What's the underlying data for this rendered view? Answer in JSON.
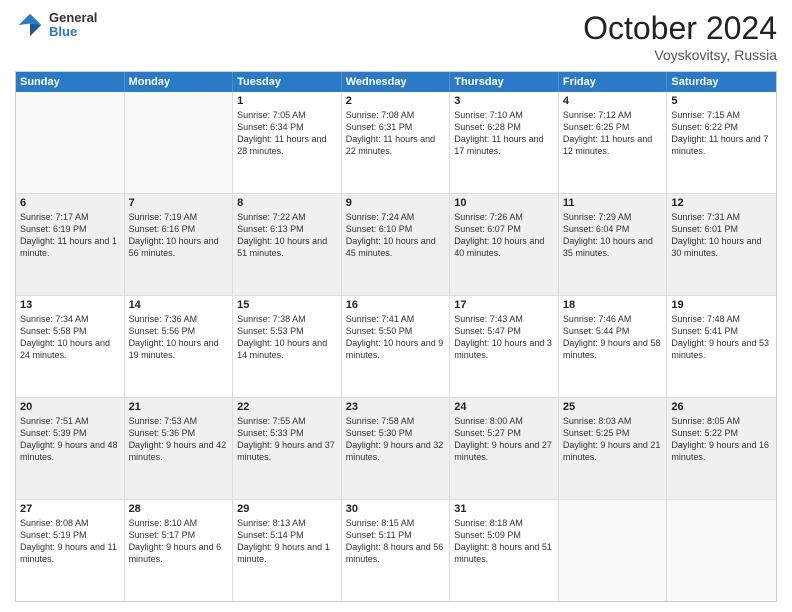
{
  "logo": {
    "general": "General",
    "blue": "Blue"
  },
  "header": {
    "month": "October 2024",
    "location": "Voyskovitsy, Russia"
  },
  "weekdays": [
    "Sunday",
    "Monday",
    "Tuesday",
    "Wednesday",
    "Thursday",
    "Friday",
    "Saturday"
  ],
  "rows": [
    [
      {
        "day": "",
        "empty": true
      },
      {
        "day": "",
        "empty": true
      },
      {
        "day": "1",
        "sunrise": "7:05 AM",
        "sunset": "6:34 PM",
        "daylight": "11 hours and 28 minutes."
      },
      {
        "day": "2",
        "sunrise": "7:08 AM",
        "sunset": "6:31 PM",
        "daylight": "11 hours and 22 minutes."
      },
      {
        "day": "3",
        "sunrise": "7:10 AM",
        "sunset": "6:28 PM",
        "daylight": "11 hours and 17 minutes."
      },
      {
        "day": "4",
        "sunrise": "7:12 AM",
        "sunset": "6:25 PM",
        "daylight": "11 hours and 12 minutes."
      },
      {
        "day": "5",
        "sunrise": "7:15 AM",
        "sunset": "6:22 PM",
        "daylight": "11 hours and 7 minutes."
      }
    ],
    [
      {
        "day": "6",
        "sunrise": "7:17 AM",
        "sunset": "6:19 PM",
        "daylight": "11 hours and 1 minute."
      },
      {
        "day": "7",
        "sunrise": "7:19 AM",
        "sunset": "6:16 PM",
        "daylight": "10 hours and 56 minutes."
      },
      {
        "day": "8",
        "sunrise": "7:22 AM",
        "sunset": "6:13 PM",
        "daylight": "10 hours and 51 minutes."
      },
      {
        "day": "9",
        "sunrise": "7:24 AM",
        "sunset": "6:10 PM",
        "daylight": "10 hours and 45 minutes."
      },
      {
        "day": "10",
        "sunrise": "7:26 AM",
        "sunset": "6:07 PM",
        "daylight": "10 hours and 40 minutes."
      },
      {
        "day": "11",
        "sunrise": "7:29 AM",
        "sunset": "6:04 PM",
        "daylight": "10 hours and 35 minutes."
      },
      {
        "day": "12",
        "sunrise": "7:31 AM",
        "sunset": "6:01 PM",
        "daylight": "10 hours and 30 minutes."
      }
    ],
    [
      {
        "day": "13",
        "sunrise": "7:34 AM",
        "sunset": "5:58 PM",
        "daylight": "10 hours and 24 minutes."
      },
      {
        "day": "14",
        "sunrise": "7:36 AM",
        "sunset": "5:56 PM",
        "daylight": "10 hours and 19 minutes."
      },
      {
        "day": "15",
        "sunrise": "7:38 AM",
        "sunset": "5:53 PM",
        "daylight": "10 hours and 14 minutes."
      },
      {
        "day": "16",
        "sunrise": "7:41 AM",
        "sunset": "5:50 PM",
        "daylight": "10 hours and 9 minutes."
      },
      {
        "day": "17",
        "sunrise": "7:43 AM",
        "sunset": "5:47 PM",
        "daylight": "10 hours and 3 minutes."
      },
      {
        "day": "18",
        "sunrise": "7:46 AM",
        "sunset": "5:44 PM",
        "daylight": "9 hours and 58 minutes."
      },
      {
        "day": "19",
        "sunrise": "7:48 AM",
        "sunset": "5:41 PM",
        "daylight": "9 hours and 53 minutes."
      }
    ],
    [
      {
        "day": "20",
        "sunrise": "7:51 AM",
        "sunset": "5:39 PM",
        "daylight": "9 hours and 48 minutes."
      },
      {
        "day": "21",
        "sunrise": "7:53 AM",
        "sunset": "5:36 PM",
        "daylight": "9 hours and 42 minutes."
      },
      {
        "day": "22",
        "sunrise": "7:55 AM",
        "sunset": "5:33 PM",
        "daylight": "9 hours and 37 minutes."
      },
      {
        "day": "23",
        "sunrise": "7:58 AM",
        "sunset": "5:30 PM",
        "daylight": "9 hours and 32 minutes."
      },
      {
        "day": "24",
        "sunrise": "8:00 AM",
        "sunset": "5:27 PM",
        "daylight": "9 hours and 27 minutes."
      },
      {
        "day": "25",
        "sunrise": "8:03 AM",
        "sunset": "5:25 PM",
        "daylight": "9 hours and 21 minutes."
      },
      {
        "day": "26",
        "sunrise": "8:05 AM",
        "sunset": "5:22 PM",
        "daylight": "9 hours and 16 minutes."
      }
    ],
    [
      {
        "day": "27",
        "sunrise": "8:08 AM",
        "sunset": "5:19 PM",
        "daylight": "9 hours and 11 minutes."
      },
      {
        "day": "28",
        "sunrise": "8:10 AM",
        "sunset": "5:17 PM",
        "daylight": "9 hours and 6 minutes."
      },
      {
        "day": "29",
        "sunrise": "8:13 AM",
        "sunset": "5:14 PM",
        "daylight": "9 hours and 1 minute."
      },
      {
        "day": "30",
        "sunrise": "8:15 AM",
        "sunset": "5:11 PM",
        "daylight": "8 hours and 56 minutes."
      },
      {
        "day": "31",
        "sunrise": "8:18 AM",
        "sunset": "5:09 PM",
        "daylight": "8 hours and 51 minutes."
      },
      {
        "day": "",
        "empty": true
      },
      {
        "day": "",
        "empty": true
      }
    ]
  ]
}
